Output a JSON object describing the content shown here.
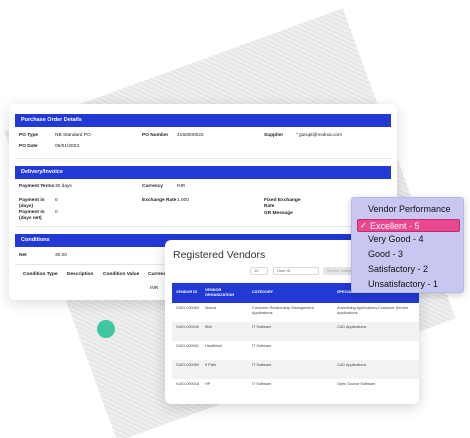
{
  "purchase_order": {
    "section_title": "Purchase Order Details",
    "po_type_label": "PO Type",
    "po_type_value": "NB Standard PO",
    "po_number_label": "PO Number",
    "po_number_value": "4150000022",
    "supplier_label": "Supplier",
    "supplier_value": "\" gurupt@mokxa.com",
    "po_date_label": "PO Date",
    "po_date_value": "06/01/2023"
  },
  "delivery": {
    "section_title": "Delivery/Invoice",
    "payment_terms_label": "Payment Terms",
    "payment_terms_value": "30 days",
    "currency_label": "Currency",
    "currency_value": "INR",
    "payment_in_days_label": "Payment in (days)",
    "payment_in_days_value": "0",
    "exchange_rate_label": "Exchange Rate",
    "exchange_rate_value": "1.000",
    "fixed_exchange_label": "Fixed Exchange Rate",
    "payment_in_net_label": "Payment in (days net)",
    "payment_in_net_value": "0",
    "gr_message_label": "GR Message"
  },
  "conditions": {
    "section_title": "Conditions",
    "net_label": "Net",
    "net_value": "30.00",
    "columns": [
      "Condition Type",
      "Description",
      "Condition Value",
      "Currency"
    ],
    "currency_value": "INR"
  },
  "vendors": {
    "title": "Registered Vendors",
    "page_size": "10",
    "user_id_placeholder": "User ID",
    "vendor_placeholder": "Vendor Name",
    "columns": [
      "VENDOR ID",
      "VENDOR ORGANIZATION",
      "CATEGORY",
      "SPECIAL"
    ],
    "rows": [
      {
        "id": "VUID-000060",
        "org": "Mokxa",
        "category": "Customer Relationship Management Applications",
        "special": "Advertising Applications,Customer Service Applications"
      },
      {
        "id": "VUID-000040",
        "org": "IBM",
        "category": "IT Software",
        "special": "CAD Applications"
      },
      {
        "id": "VUID-000061",
        "org": "Healthhub",
        "category": "IT Software",
        "special": ""
      },
      {
        "id": "VUID-000059",
        "org": "9 Path",
        "category": "IT Software",
        "special": "CAD Applications"
      },
      {
        "id": "VUID-000018",
        "org": "HP",
        "category": "IT Software",
        "special": "Open Source Software"
      }
    ]
  },
  "performance_dropdown": {
    "heading": "Vendor Performance",
    "selected": "Excellent - 5",
    "options": [
      "Very Good - 4",
      "Good - 3",
      "Satisfactory - 2",
      "Unsatisfactory - 1"
    ],
    "check_glyph": "✓",
    "selected_color": "#e9488e"
  },
  "colors": {
    "accent": "#2239d6",
    "decor_dot": "#3ec6a5"
  }
}
